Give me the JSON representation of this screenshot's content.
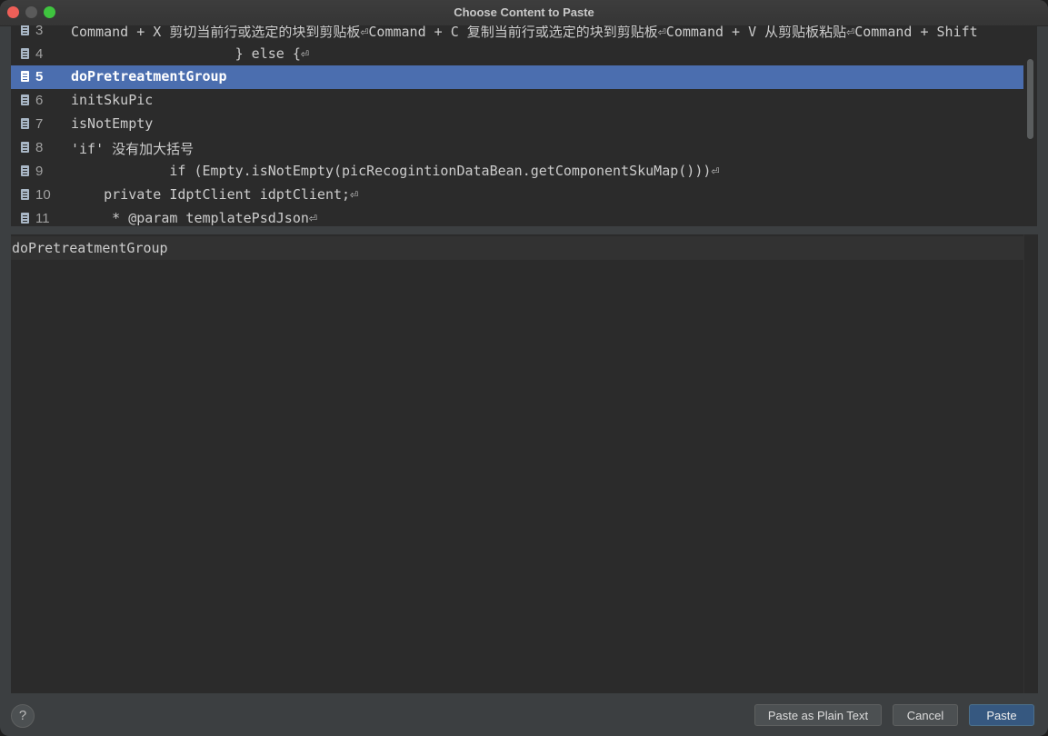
{
  "window": {
    "title": "Choose Content to Paste"
  },
  "clipboard_list": {
    "items": [
      {
        "number": "3",
        "text": "Command + X 剪切当前行或选定的块到剪贴板⏎Command + C 复制当前行或选定的块到剪贴板⏎Command + V 从剪贴板粘贴⏎Command + Shift",
        "selected": false
      },
      {
        "number": "4",
        "text": "                    } else {⏎",
        "selected": false
      },
      {
        "number": "5",
        "text": "doPretreatmentGroup",
        "selected": true
      },
      {
        "number": "6",
        "text": "initSkuPic",
        "selected": false
      },
      {
        "number": "7",
        "text": "isNotEmpty",
        "selected": false
      },
      {
        "number": "8",
        "text": "'if' 没有加大括号",
        "selected": false
      },
      {
        "number": "9",
        "text": "            if (Empty.isNotEmpty(picRecogintionDataBean.getComponentSkuMap()))⏎",
        "selected": false
      },
      {
        "number": "10",
        "text": "    private IdptClient idptClient;⏎",
        "selected": false
      },
      {
        "number": "11",
        "text": "     * @param templatePsdJson⏎",
        "selected": false
      }
    ]
  },
  "preview": {
    "text": "doPretreatmentGroup"
  },
  "buttons": {
    "help": "?",
    "paste_plain": "Paste as Plain Text",
    "cancel": "Cancel",
    "paste": "Paste"
  },
  "colors": {
    "selection": "#4b6eaf",
    "default_button": "#365880",
    "editor_bg": "#2b2b2b",
    "window_bg": "#3c3f41"
  }
}
